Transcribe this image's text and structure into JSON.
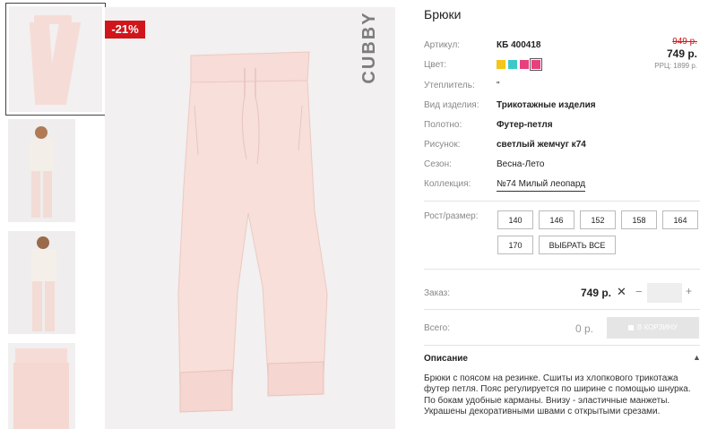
{
  "gallery": {
    "discount_badge": "-21%",
    "brand_label": "CUBBY"
  },
  "product": {
    "title": "Брюки",
    "price": {
      "old": "949 р.",
      "new": "749 р.",
      "rrp": "РРЦ: 1899 р."
    },
    "attributes": [
      {
        "label": "Артикул:",
        "value": "КБ 400418"
      },
      {
        "label": "Цвет:",
        "value": ""
      },
      {
        "label": "Утеплитель:",
        "value": "\""
      },
      {
        "label": "Вид изделия:",
        "value": "Трикотажные изделия"
      },
      {
        "label": "Полотно:",
        "value": "Футер-петля"
      },
      {
        "label": "Рисунок:",
        "value": "светлый жемчуг к74"
      },
      {
        "label": "Сезон:",
        "value": "Весна-Лето"
      },
      {
        "label": "Коллекция:",
        "value": "№74 Милый леопард"
      }
    ],
    "colors": [
      "#f5c518",
      "#3ec9c9",
      "#e8407c",
      "#e8407c"
    ],
    "sizes_label": "Рост/размер:",
    "sizes": [
      "140",
      "146",
      "152",
      "158",
      "164",
      "170"
    ],
    "select_all": "ВЫБРАТЬ ВСЕ",
    "order_label": "Заказ:",
    "order_price": "749 р.",
    "total_label": "Всего:",
    "total_value": "0 р.",
    "cart_button": "В КОРЗИНУ",
    "description_title": "Описание",
    "description": "Брюки с поясом на резинке. Сшиты из хлопкового трикотажа футер петля. Пояс регулируется по ширине с помощью шнурка. По бокам удобные карманы. Внизу - эластичные манжеты. Украшены декоративными швами с открытыми срезами."
  }
}
